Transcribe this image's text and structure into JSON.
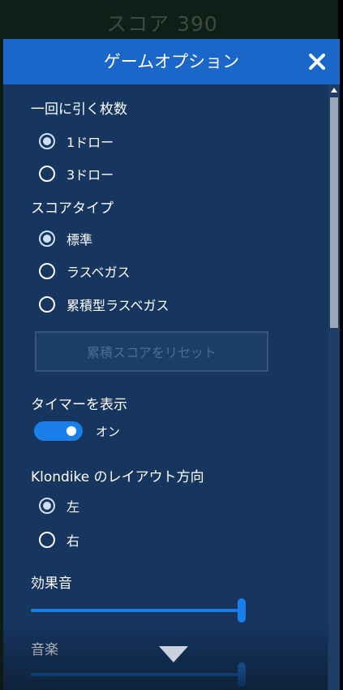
{
  "background": {
    "score_text": "スコア 390"
  },
  "dialog": {
    "title": "ゲームオプション",
    "close_icon": "close-icon",
    "draw_count": {
      "title": "一回に引く枚数",
      "options": [
        {
          "label": "1ドロー",
          "checked": true
        },
        {
          "label": "3ドロー",
          "checked": false
        }
      ]
    },
    "score_type": {
      "title": "スコアタイプ",
      "options": [
        {
          "label": "標準",
          "checked": true
        },
        {
          "label": "ラスベガス",
          "checked": false
        },
        {
          "label": "累積型ラスベガス",
          "checked": false
        }
      ],
      "reset_button": "累積スコアをリセット"
    },
    "timer": {
      "title": "タイマーを表示",
      "state_label": "オン",
      "on": true
    },
    "layout": {
      "title": "Klondike のレイアウト方向",
      "options": [
        {
          "label": "左",
          "checked": true
        },
        {
          "label": "右",
          "checked": false
        }
      ]
    },
    "sound_effects": {
      "title": "効果音",
      "value": 1.0
    },
    "music": {
      "title": "音楽",
      "value": 1.0
    }
  },
  "colors": {
    "panel": "#163660",
    "titlebar": "#1a66c9",
    "accent": "#1a7fe8"
  }
}
